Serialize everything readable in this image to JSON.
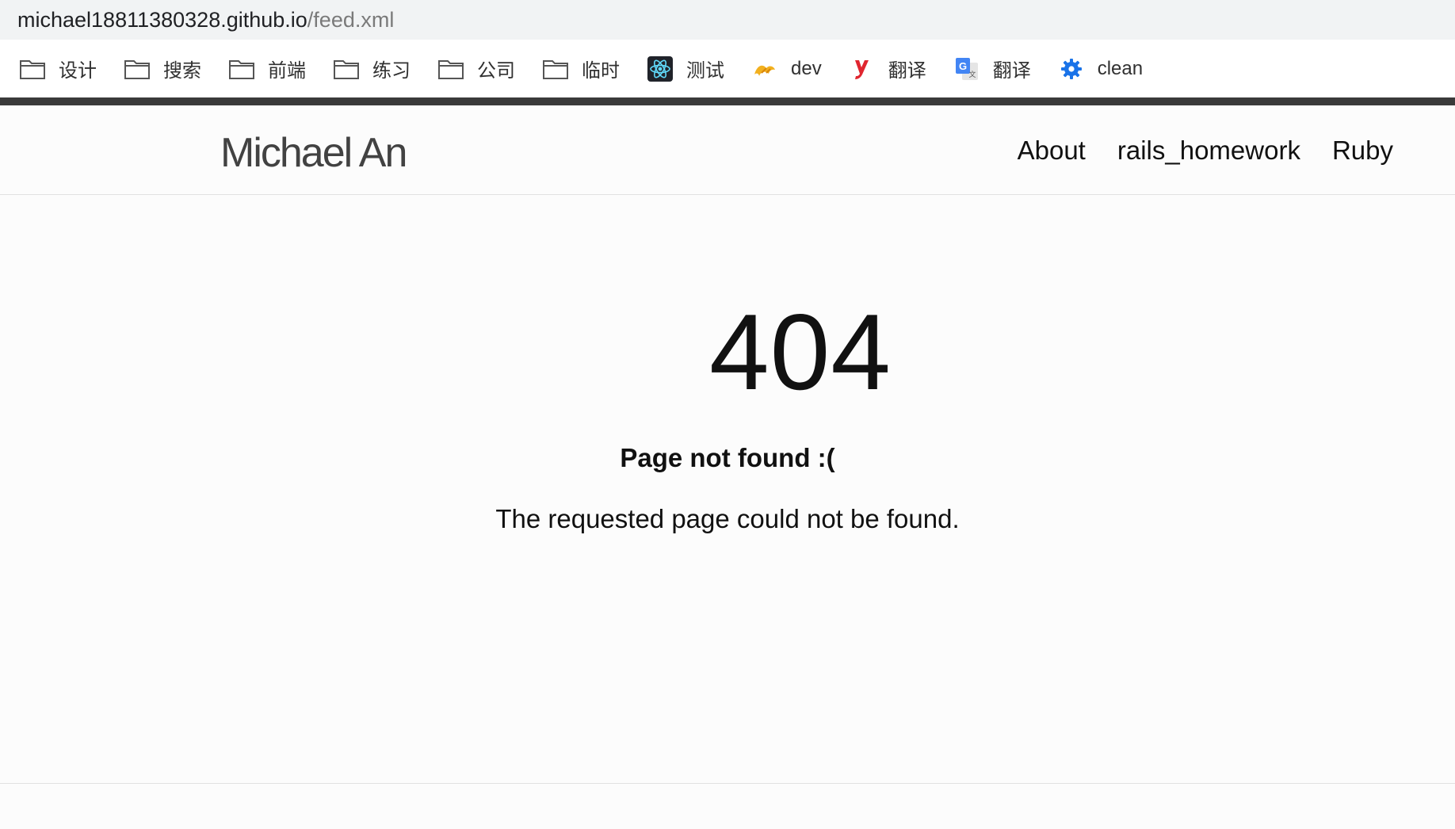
{
  "address_bar": {
    "host": "michael18811380328.github.io",
    "path": "/feed.xml"
  },
  "bookmarks": [
    {
      "label": "设计",
      "icon": "folder-icon"
    },
    {
      "label": "搜索",
      "icon": "folder-icon"
    },
    {
      "label": "前端",
      "icon": "folder-icon"
    },
    {
      "label": "练习",
      "icon": "folder-icon"
    },
    {
      "label": "公司",
      "icon": "folder-icon"
    },
    {
      "label": "临时",
      "icon": "folder-icon"
    },
    {
      "label": "测试",
      "icon": "react-icon"
    },
    {
      "label": "dev",
      "icon": "dev-bird-icon"
    },
    {
      "label": "翻译",
      "icon": "youdao-icon"
    },
    {
      "label": "翻译",
      "icon": "google-translate-icon"
    },
    {
      "label": "clean",
      "icon": "gear-icon"
    }
  ],
  "site": {
    "title": "Michael An",
    "nav": [
      "About",
      "rails_homework",
      "Ruby"
    ]
  },
  "error": {
    "code": "404",
    "title": "Page not found :(",
    "message": "The requested page could not be found."
  },
  "colors": {
    "stripe": "#3a3a3a",
    "address_bar_bg": "#f1f3f4",
    "page_bg": "#fcfcfc"
  }
}
